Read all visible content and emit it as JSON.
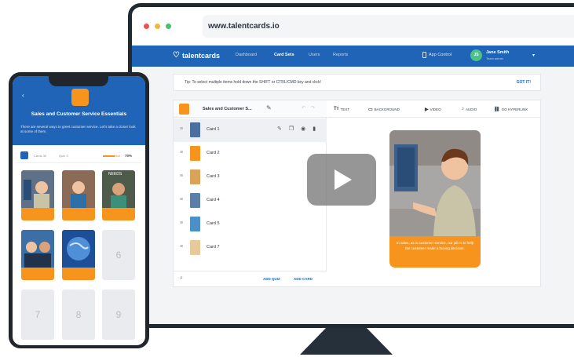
{
  "browser": {
    "url": "www.talentcards.io"
  },
  "nav": {
    "logo": "talentcards",
    "items": [
      "Dashboard",
      "Card Sets",
      "Users",
      "Reports"
    ],
    "active_index": 1,
    "app_control": "App Control",
    "user_initials": "JS",
    "user_name": "Jane Smith",
    "user_role": "Team admin"
  },
  "tip": {
    "text": "Tip: To select multiple items hold down the SHIFT or CTRL/CMD key and click!",
    "action": "GOT IT!"
  },
  "editor": {
    "deck_title": "Sales and Customer S...",
    "cards": [
      {
        "label": "Card 1"
      },
      {
        "label": "Card 2"
      },
      {
        "label": "Card 3"
      },
      {
        "label": "Card 4"
      },
      {
        "label": "Card 5"
      },
      {
        "label": "Card 7"
      }
    ],
    "footer": {
      "add_quiz": "ADD QUIZ",
      "add_card": "ADD CARD"
    },
    "toolbar": [
      {
        "icon": "Tт",
        "label": "TEXT"
      },
      {
        "icon": "▭",
        "label": "BACKGROUND"
      },
      {
        "icon": "▶",
        "label": "VIDEO"
      },
      {
        "icon": "♪",
        "label": "AUDIO"
      },
      {
        "icon": "⛓",
        "label": "GO HYPERLINK"
      }
    ],
    "preview_caption": "In sales, as in customer service, our job is to help the customer make a buying decision."
  },
  "phone": {
    "title": "Sales and Customer Service Essentials",
    "subtitle": "There are several ways to greet customer service. Let's take a closer look at some of them.",
    "stat_cards": "Cards 30",
    "stat_quiz": "Quiz 3",
    "progress_percent": 70,
    "progress_label": "70%",
    "tile_needs": "NEEDS",
    "empty_tiles": [
      "6",
      "7",
      "8",
      "9"
    ]
  },
  "colors": {
    "brand_blue": "#1f64b6",
    "accent_orange": "#f7941d",
    "device_dark": "#222a31"
  }
}
